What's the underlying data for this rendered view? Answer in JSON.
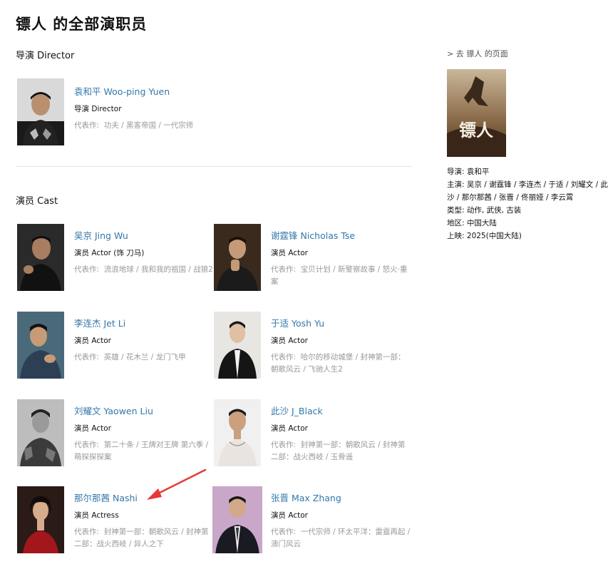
{
  "page_title": "镖人 的全部演职员",
  "director_section": "导演 Director",
  "cast_section": "演员 Cast",
  "works_label": "代表作:",
  "director": {
    "name": "袁和平 Woo-ping Yuen",
    "role": "导演 Director",
    "works": [
      "功夫",
      "黑客帝国",
      "一代宗师"
    ]
  },
  "cast": [
    {
      "name": "吴京 Jing Wu",
      "role": "演员 Actor (饰 刀马)",
      "works_text": "流浪地球 / 我和我的祖国 / 战狼2"
    },
    {
      "name": "谢霆锋 Nicholas Tse",
      "role": "演员 Actor",
      "works_text": "宝贝计划 / 新警察故事 / 怒火·重案"
    },
    {
      "name": "李连杰 Jet Li",
      "role": "演员 Actor",
      "works_text": "英雄 / 花木兰 / 龙门飞甲"
    },
    {
      "name": "于适 Yosh Yu",
      "role": "演员 Actor",
      "works_text": "哈尔的移动城堡 / 封神第一部：朝歌风云 / 飞驰人生2"
    },
    {
      "name": "刘耀文 Yaowen Liu",
      "role": "演员 Actor",
      "works_text": "第二十条 / 王牌对王牌 第六季 / 萌探探探案"
    },
    {
      "name": "此沙 J_Black",
      "role": "演员 Actor",
      "works_text": "封神第一部：朝歌风云 / 封神第二部：战火西岐 / 玉骨遥"
    },
    {
      "name": "那尔那茜 Nashi",
      "role": "演员 Actress",
      "works_text": "封神第一部：朝歌风云 / 封神第二部：战火西岐 / 异人之下"
    },
    {
      "name": "张晋 Max Zhang",
      "role": "演员 Actor",
      "works_text": "一代宗师 / 环太平洋：雷霆再起 / 澳门风云"
    }
  ],
  "sidebar": {
    "link": "> 去 镖人 的页面",
    "poster_text": "镖人",
    "director": {
      "key": "导演:",
      "value": "袁和平"
    },
    "stars": {
      "key": "主演:",
      "value": "吴京 / 谢霆锋 / 李连杰 / 于适 / 刘耀文 / 此沙 / 那尔那茜 / 张晋 / 佟丽娅 / 李云霄"
    },
    "genre": {
      "key": "类型:",
      "value": "动作, 武侠, 古装"
    },
    "region": {
      "key": "地区:",
      "value": "中国大陆"
    },
    "release": {
      "key": "上映:",
      "value": "2025(中国大陆)"
    }
  },
  "colors": {
    "link": "#3377aa",
    "muted": "#999999",
    "annotation_arrow": "#e53935"
  }
}
